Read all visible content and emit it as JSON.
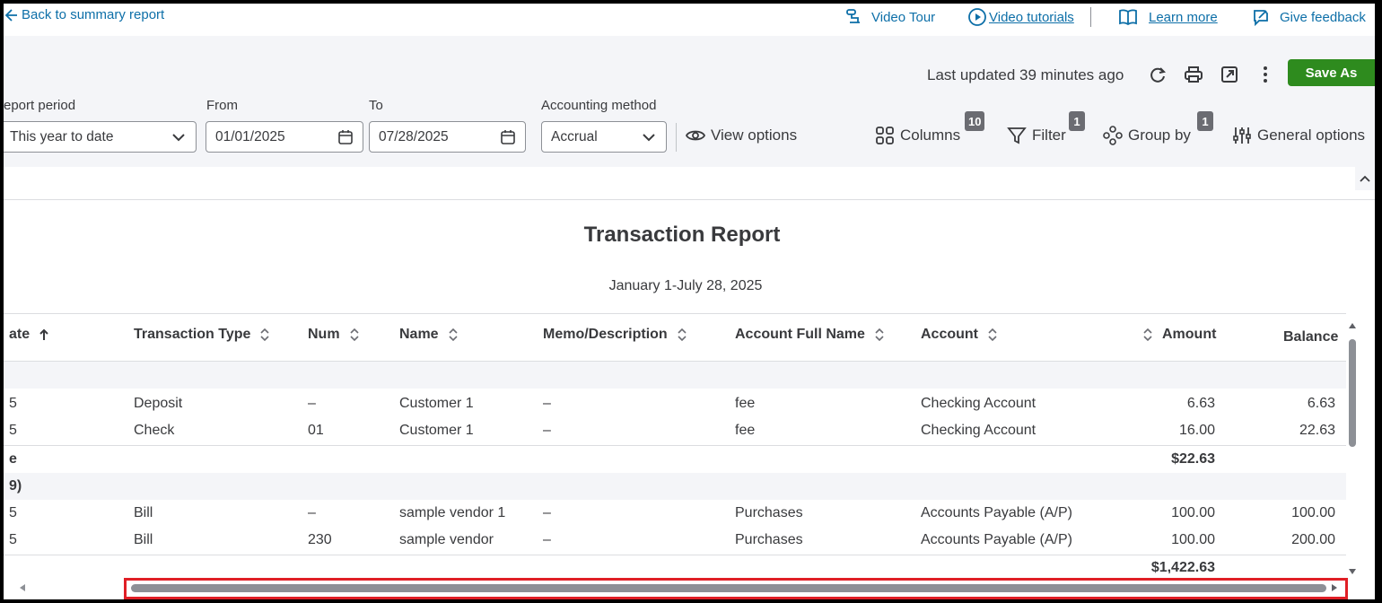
{
  "topbar": {
    "back": "Back to summary report",
    "video_tour": "Video Tour",
    "video_tutorials": "Video tutorials",
    "learn_more": "Learn more",
    "give_feedback": "Give feedback"
  },
  "toolbar": {
    "last_updated": "Last updated 39 minutes ago",
    "save_as": "Save As"
  },
  "filters": {
    "report_period_label": "eport period",
    "report_period_value": "This year to date",
    "from_label": "From",
    "from_value": "01/01/2025",
    "to_label": "To",
    "to_value": "07/28/2025",
    "method_label": "Accounting method",
    "method_value": "Accrual"
  },
  "options": {
    "view": "View options",
    "columns": "Columns",
    "columns_count": "10",
    "filter": "Filter",
    "filter_count": "1",
    "group_by": "Group by",
    "group_by_count": "1",
    "general": "General options"
  },
  "report": {
    "title": "Transaction Report",
    "subtitle": "January 1-July 28, 2025",
    "columns": [
      "ate",
      "Transaction Type",
      "Num",
      "Name",
      "Memo/Description",
      "Account Full Name",
      "Account",
      "Amount",
      "Balance"
    ],
    "rows": [
      {
        "date": "5",
        "type": "Deposit",
        "num": "–",
        "name": "Customer 1",
        "memo": "–",
        "full": "fee",
        "account": "Checking Account",
        "amount": "6.63",
        "balance": "6.63"
      },
      {
        "date": "5",
        "type": "Check",
        "num": "01",
        "name": "Customer 1",
        "memo": "–",
        "full": "fee",
        "account": "Checking Account",
        "amount": "16.00",
        "balance": "22.63"
      },
      {
        "date": "5",
        "type": "Bill",
        "num": "–",
        "name": "sample vendor 1",
        "memo": "–",
        "full": "Purchases",
        "account": "Accounts Payable (A/P)",
        "amount": "100.00",
        "balance": "100.00"
      },
      {
        "date": "5",
        "type": "Bill",
        "num": "230",
        "name": "sample vendor",
        "memo": "–",
        "full": "Purchases",
        "account": "Accounts Payable (A/P)",
        "amount": "100.00",
        "balance": "200.00"
      }
    ],
    "group1_total_label": "e",
    "group1_total": "$22.63",
    "group2_label": "9)",
    "grand_total": "$1,422.63"
  }
}
